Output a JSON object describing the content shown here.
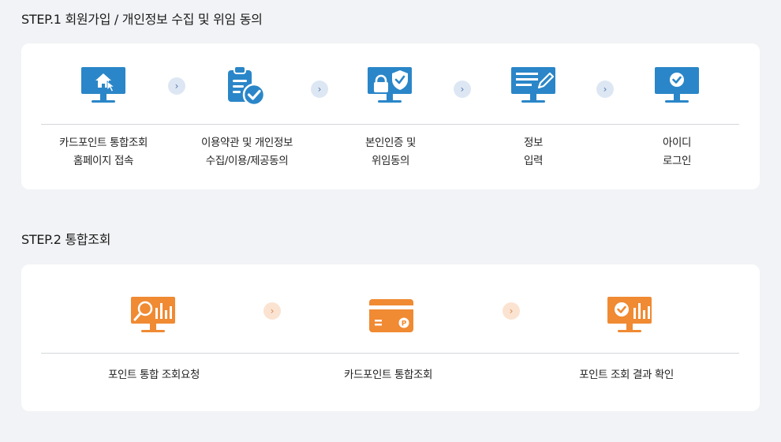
{
  "step1": {
    "title": "STEP.1 회원가입 / 개인정보 수집 및 위임 동의",
    "steps": [
      {
        "icon": "home-monitor-icon",
        "line1": "카드포인트 통합조회",
        "line2": "홈페이지 접속"
      },
      {
        "icon": "clipboard-check-icon",
        "line1": "이용약관 및 개인정보",
        "line2": "수집/이용/제공동의"
      },
      {
        "icon": "lock-shield-monitor-icon",
        "line1": "본인인증 및",
        "line2": "위임동의"
      },
      {
        "icon": "edit-form-monitor-icon",
        "line1": "정보",
        "line2": "입력"
      },
      {
        "icon": "check-monitor-icon",
        "line1": "아이디",
        "line2": "로그인"
      }
    ],
    "arrow": "›",
    "accent": "#2a86c8"
  },
  "step2": {
    "title": "STEP.2 통합조회",
    "steps": [
      {
        "icon": "search-chart-monitor-icon",
        "line1": "포인트 통합 조회요청"
      },
      {
        "icon": "point-card-icon",
        "line1": "카드포인트 통합조회"
      },
      {
        "icon": "check-chart-monitor-icon",
        "line1": "포인트 조회 결과 확인"
      }
    ],
    "arrow": "›",
    "accent": "#f08a33"
  }
}
